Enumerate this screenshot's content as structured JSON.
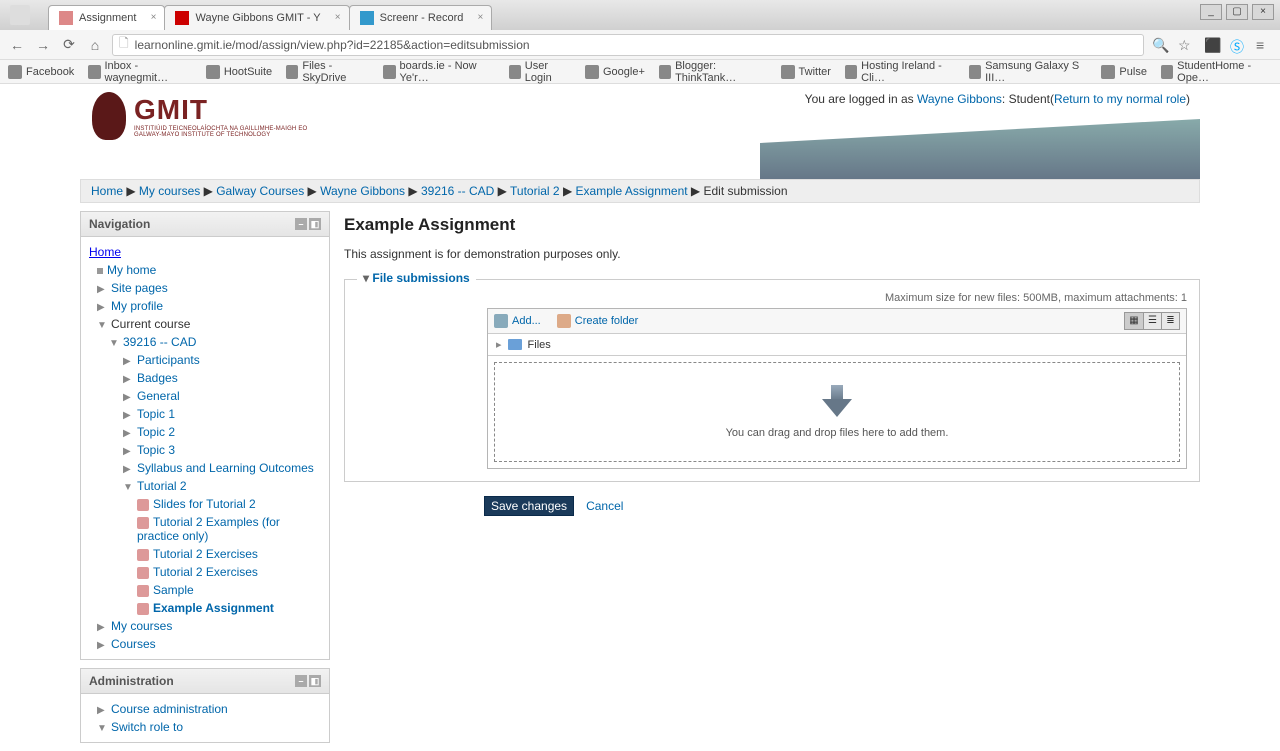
{
  "browser": {
    "tabs": [
      {
        "title": "Assignment",
        "icon": "assignment-icon",
        "active": true
      },
      {
        "title": "Wayne Gibbons GMIT - Y",
        "icon": "youtube-icon",
        "active": false
      },
      {
        "title": "Screenr - Record",
        "icon": "screenr-icon",
        "active": false
      }
    ],
    "url": "learnonline.gmit.ie/mod/assign/view.php?id=22185&action=editsubmission",
    "bookmarks": [
      {
        "label": "Facebook"
      },
      {
        "label": "Inbox - waynegmit…"
      },
      {
        "label": "HootSuite"
      },
      {
        "label": "Files - SkyDrive"
      },
      {
        "label": "boards.ie - Now Ye'r…"
      },
      {
        "label": "User Login"
      },
      {
        "label": "Google+"
      },
      {
        "label": "Blogger: ThinkTank…"
      },
      {
        "label": "Twitter"
      },
      {
        "label": "Hosting Ireland - Cli…"
      },
      {
        "label": "Samsung Galaxy S III…"
      },
      {
        "label": "Pulse"
      },
      {
        "label": "StudentHome - Ope…"
      }
    ],
    "window_controls": {
      "minimize": "_",
      "maximize": "▢",
      "close": "×"
    }
  },
  "header": {
    "logo_text": "GMIT",
    "logo_sub1": "INSTITIÚID TEICNEOLAÍOCHTA NA GAILLIMHE-MAIGH EO",
    "logo_sub2": "GALWAY-MAYO INSTITUTE OF TECHNOLOGY",
    "login_prefix": "You are logged in as ",
    "login_user": "Wayne Gibbons",
    "login_role": ": Student(",
    "login_return": "Return to my normal role",
    "login_close": ")"
  },
  "breadcrumb": {
    "items": [
      "Home",
      "My courses",
      "Galway Courses",
      "Wayne Gibbons",
      "39216 -- CAD",
      "Tutorial 2",
      "Example Assignment",
      "Edit submission"
    ],
    "sep": "▶"
  },
  "nav_block": {
    "title": "Navigation",
    "home": "Home",
    "items": [
      {
        "label": "My home",
        "lvl": 1,
        "type": "sq"
      },
      {
        "label": "Site pages",
        "lvl": 1,
        "type": "exp",
        "sym": "▶"
      },
      {
        "label": "My profile",
        "lvl": 1,
        "type": "exp",
        "sym": "▶"
      },
      {
        "label": "Current course",
        "lvl": 1,
        "type": "exp",
        "sym": "▼",
        "plain": true
      },
      {
        "label": "39216 -- CAD",
        "lvl": 2,
        "type": "exp",
        "sym": "▼",
        "link": true
      },
      {
        "label": "Participants",
        "lvl": 3,
        "type": "exp",
        "sym": "▶",
        "link": true
      },
      {
        "label": "Badges",
        "lvl": 3,
        "type": "exp",
        "sym": "▶",
        "link": true
      },
      {
        "label": "General",
        "lvl": 3,
        "type": "exp",
        "sym": "▶",
        "link": true
      },
      {
        "label": "Topic 1",
        "lvl": 3,
        "type": "exp",
        "sym": "▶",
        "link": true
      },
      {
        "label": "Topic 2",
        "lvl": 3,
        "type": "exp",
        "sym": "▶",
        "link": true
      },
      {
        "label": "Topic 3",
        "lvl": 3,
        "type": "exp",
        "sym": "▶",
        "link": true
      },
      {
        "label": "Syllabus and Learning Outcomes",
        "lvl": 3,
        "type": "exp",
        "sym": "▶",
        "link": true
      },
      {
        "label": "Tutorial 2",
        "lvl": 3,
        "type": "exp",
        "sym": "▼",
        "link": true
      },
      {
        "label": "Slides for Tutorial 2",
        "lvl": 4,
        "type": "ico",
        "link": true
      },
      {
        "label": "Tutorial 2 Examples (for practice only)",
        "lvl": 4,
        "type": "ico",
        "link": true
      },
      {
        "label": "Tutorial 2 Exercises",
        "lvl": 4,
        "type": "ico",
        "link": true
      },
      {
        "label": "Tutorial 2 Exercises",
        "lvl": 4,
        "type": "ico",
        "link": true
      },
      {
        "label": "Sample",
        "lvl": 4,
        "type": "ico",
        "link": true
      },
      {
        "label": "Example Assignment",
        "lvl": 4,
        "type": "ico",
        "link": true,
        "bold": true
      },
      {
        "label": "My courses",
        "lvl": 1,
        "type": "exp",
        "sym": "▶",
        "link": true
      },
      {
        "label": "Courses",
        "lvl": 1,
        "type": "exp",
        "sym": "▶",
        "link": true
      }
    ]
  },
  "admin_block": {
    "title": "Administration",
    "items": [
      {
        "label": "Course administration",
        "sym": "▶"
      },
      {
        "label": "Switch role to",
        "sym": "▼"
      }
    ]
  },
  "main": {
    "title": "Example Assignment",
    "desc": "This assignment is for demonstration purposes only.",
    "fieldset_legend": "File submissions",
    "file_limit": "Maximum size for new files: 500MB, maximum attachments: 1",
    "add_label": "Add...",
    "folder_label": "Create folder",
    "files_label": "Files",
    "drop_text": "You can drag and drop files here to add them.",
    "save_label": "Save changes",
    "cancel_label": "Cancel"
  }
}
